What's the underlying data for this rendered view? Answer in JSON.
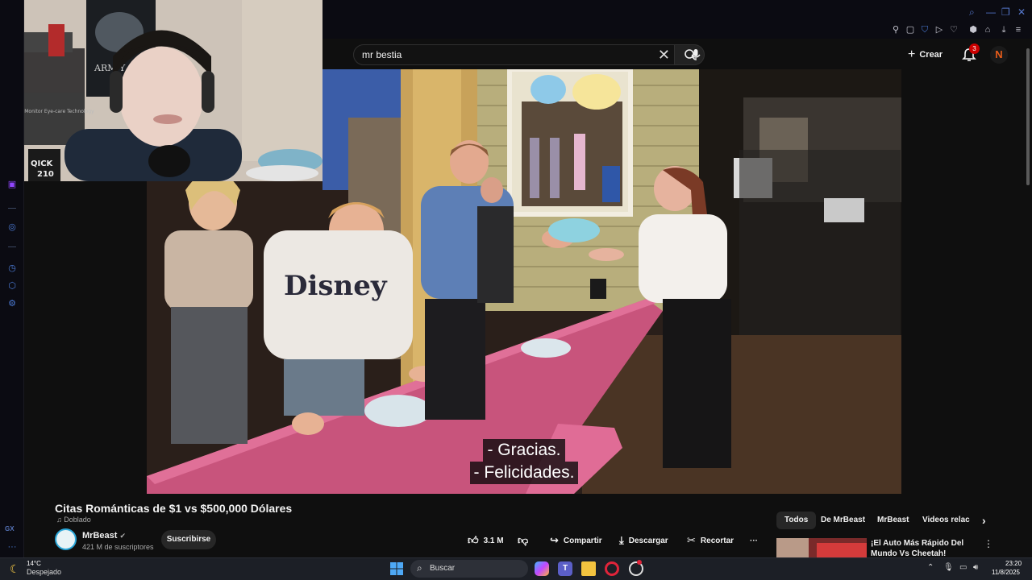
{
  "browser": {
    "sidebar_label": "GX",
    "accent": "#4b7bd6"
  },
  "masthead": {
    "search_value": "mr bestia",
    "create_label": "Crear",
    "notification_count": "3",
    "avatar_letter": "N"
  },
  "webcam": {
    "poster_text": "ARM Y",
    "sticker_text": "QICK",
    "sticker_number": "210",
    "box_text": "Stylus Monitor Eye-care Technology"
  },
  "video": {
    "subtitle_lines": [
      "- Gracias.",
      "- Felicidades."
    ],
    "shirt_text": "Disney"
  },
  "video_info": {
    "title": "Citas Románticas de $1 vs $500,000 Dólares",
    "dubbed_label": "Doblado",
    "channel_name": "MrBeast",
    "subscribers": "421 M de suscriptores",
    "subscribe_label": "Suscribirse",
    "likes": "3.1 M",
    "share_label": "Compartir",
    "download_label": "Descargar",
    "clip_label": "Recortar",
    "more_label": "···"
  },
  "related": {
    "chips": [
      "Todos",
      "De MrBeast",
      "MrBeast",
      "Videos relac"
    ],
    "first_title": "¡El Auto Más Rápido Del Mundo Vs Cheetah!"
  },
  "taskbar": {
    "temperature": "14°C",
    "weather": "Despejado",
    "search_label": "Buscar",
    "time": "23:20",
    "date": "11/8/2025"
  }
}
